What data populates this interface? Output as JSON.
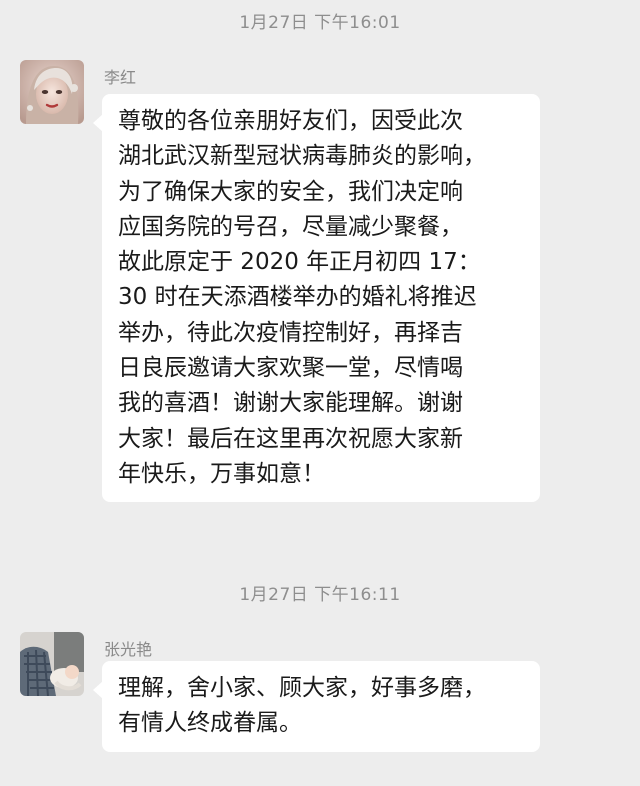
{
  "messages": [
    {
      "timestamp": "1月27日 下午16:01",
      "sender": "李红",
      "avatar_icon": "woman-portrait-avatar",
      "lines": [
        "尊敬的各位亲朋好友们，因受此次",
        "湖北武汉新型冠状病毒肺炎的影响，",
        "为了确保大家的安全，我们决定响",
        "应国务院的号召，尽量减少聚餐，",
        "故此原定于 2020 年正月初四 17：",
        "30 时在天添酒楼举办的婚礼将推迟",
        "举办，待此次疫情控制好，再择吉",
        "日良辰邀请大家欢聚一堂，尽情喝",
        "我的喜酒！谢谢大家能理解。谢谢",
        "大家！最后在这里再次祝愿大家新",
        "年快乐，万事如意！"
      ]
    },
    {
      "timestamp": "1月27日 下午16:11",
      "sender": "张光艳",
      "avatar_icon": "parent-with-baby-avatar",
      "lines": [
        "理解，舍小家、顾大家，好事多磨，",
        "有情人终成眷属。"
      ]
    }
  ],
  "colors": {
    "background": "#ededed",
    "bubble": "#ffffff",
    "timestamp_text": "#8e8e8e",
    "name_text": "#8a8a8a",
    "message_text": "#1a1a1a"
  }
}
